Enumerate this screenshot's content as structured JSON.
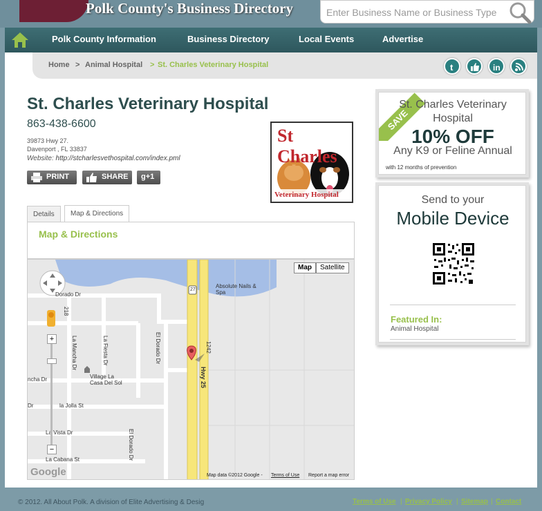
{
  "header": {
    "site_title": "Polk County's Business Directory",
    "search_placeholder": "Enter Business Name or Business Type",
    "search_icon": "search-icon"
  },
  "nav": {
    "home_icon": "home-icon",
    "items": [
      {
        "label": "Polk County Information"
      },
      {
        "label": "Business Directory"
      },
      {
        "label": "Local Events"
      },
      {
        "label": "Advertise"
      }
    ]
  },
  "breadcrumb": {
    "items": [
      "Home",
      "Animal Hospital",
      "St. Charles Veterinary Hospital"
    ],
    "separator": ">"
  },
  "social": [
    "twitter-icon",
    "facebook-like-icon",
    "linkedin-icon",
    "rss-icon"
  ],
  "business": {
    "name": "St. Charles Veterinary Hospital",
    "phone": "863-438-6600",
    "address_line1": "39873 Hwy 27.",
    "address_line2": "Davenport , FL 33837",
    "website_label": "Website:",
    "website_url": "http://stcharlesvethospital.com/index.pml",
    "logo_line1": "St Charles",
    "logo_line2": "Veterinary Hospital"
  },
  "actions": {
    "print": "PRINT",
    "share": "SHARE",
    "gplus": "+1"
  },
  "tabs": [
    {
      "label": "Details",
      "active": false
    },
    {
      "label": "Map & Directions",
      "active": true
    }
  ],
  "map": {
    "section_title": "Map & Directions",
    "type_map": "Map",
    "type_satellite": "Satellite",
    "labels": {
      "dorado": "Dorado Dr",
      "la_mancha": "La Mancha Dr",
      "la_fiesta": "La Fiesta Dr",
      "el_dorado_top": "El Dorado Dr",
      "el_dorado_bottom": "El Dorado Dr",
      "hwy25": "Hwy 25",
      "absolute": "Absolute Nails & Spa",
      "village": "Village La Casa Del Sol",
      "mancha": "ncha Dr",
      "jolla": "la Jolla St",
      "vista": "La Vista Dr",
      "cabana": "La Cabana St",
      "dr_left": "Dr",
      "shield27": "27",
      "num1242": "1242",
      "num218": "218"
    },
    "google": "Google",
    "map_data": "Map data ©2012 Google -",
    "terms": "Terms of Use",
    "report": "Report a map error"
  },
  "coupon": {
    "ribbon": "SAVE",
    "business": "St. Charles Veterinary Hospital",
    "offer": "10% OFF",
    "desc": "Any K9 or Feline Annual",
    "note": "with 12 months of prevention"
  },
  "mobile": {
    "send": "Send to your",
    "device": "Mobile Device",
    "featured_heading": "Featured In:",
    "featured_category": "Animal Hospital"
  },
  "footer": {
    "copyright": "© 2012. All About Polk. A division of Elite Advertising & Desig",
    "links": [
      "Terms of Use",
      "Privacy Policy",
      "Sitemap",
      "Contact"
    ],
    "sep": "|"
  },
  "colors": {
    "accent_green": "#98c04c",
    "nav_teal": "#2e575d",
    "heading_dark": "#2e4e4e",
    "brand_maroon": "#6d1f34"
  }
}
